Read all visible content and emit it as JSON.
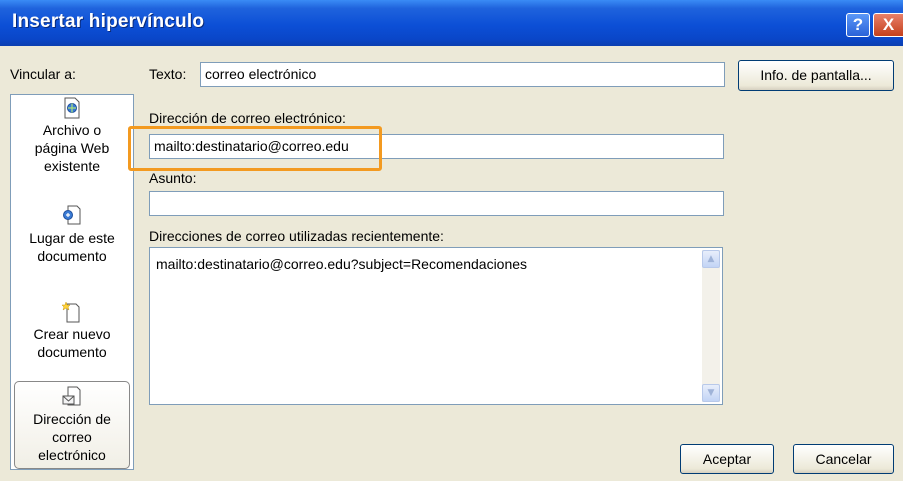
{
  "window": {
    "title": "Insertar hipervínculo",
    "help_label": "?",
    "close_label": "X"
  },
  "sidebar": {
    "heading": "Vincular a:",
    "items": [
      {
        "line1": "Archivo o",
        "line2": "página Web",
        "line3": "existente",
        "icon": "file-web-icon"
      },
      {
        "line1": "Lugar de este",
        "line2": "documento",
        "icon": "place-in-document-icon"
      },
      {
        "line1": "Crear nuevo",
        "line2": "documento",
        "icon": "new-document-icon"
      },
      {
        "line1": "Dirección de",
        "line2": "correo",
        "line3": "electrónico",
        "icon": "email-address-icon",
        "selected": true
      }
    ]
  },
  "form": {
    "text_label": "Texto:",
    "text_value": "correo electrónico",
    "screen_tip_button": "Info. de pantalla...",
    "email_label": "Dirección de correo electrónico:",
    "email_value": "mailto:destinatario@correo.edu",
    "subject_label": "Asunto:",
    "subject_value": "",
    "recent_label": "Direcciones de correo utilizadas recientemente:",
    "recent_items": [
      "mailto:destinatario@correo.edu?subject=Recomendaciones"
    ]
  },
  "buttons": {
    "ok": "Aceptar",
    "cancel": "Cancelar"
  },
  "colors": {
    "titlebar": "#0c4fd6",
    "highlight": "#f39a20",
    "dialog_bg": "#ece9d8"
  }
}
